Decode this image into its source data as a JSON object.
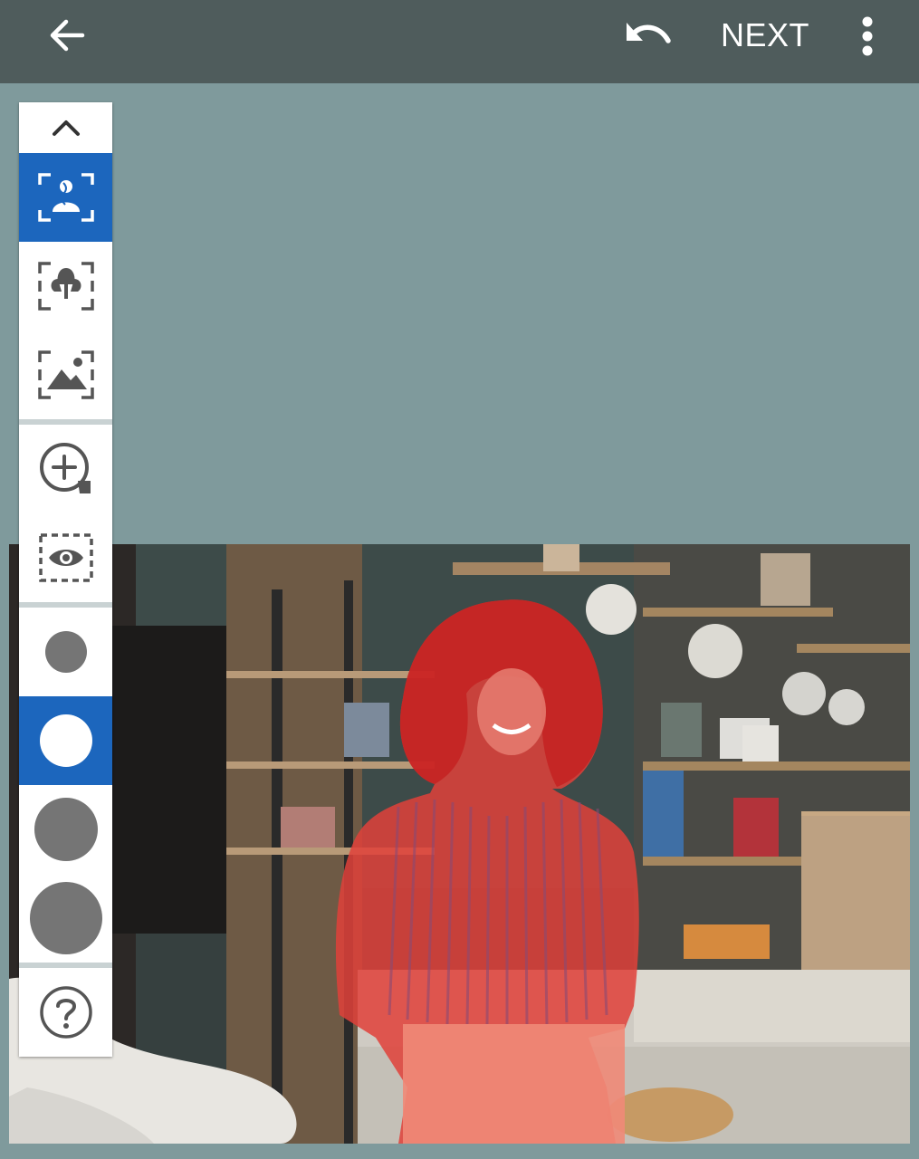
{
  "topbar": {
    "back_icon": "arrow-left-icon",
    "undo_icon": "undo-icon",
    "next_label": "NEXT",
    "more_icon": "more-vertical-icon"
  },
  "toolbar": {
    "tools": [
      {
        "name": "collapse",
        "icon": "chevron-up-icon",
        "selected": false
      },
      {
        "name": "person-select",
        "icon": "person-focus-icon",
        "selected": true
      },
      {
        "name": "object-select",
        "icon": "object-focus-icon",
        "selected": false
      },
      {
        "name": "background-select",
        "icon": "landscape-focus-icon",
        "selected": false
      },
      {
        "name": "add-area",
        "icon": "add-circle-icon",
        "selected": false
      },
      {
        "name": "preview",
        "icon": "eye-icon",
        "selected": false
      },
      {
        "name": "brush-small",
        "icon": "brush-size-small-icon",
        "selected": false
      },
      {
        "name": "brush-medium",
        "icon": "brush-size-medium-icon",
        "selected": true
      },
      {
        "name": "brush-large",
        "icon": "brush-size-large-icon",
        "selected": false
      },
      {
        "name": "brush-xlarge",
        "icon": "brush-size-xlarge-icon",
        "selected": false
      },
      {
        "name": "help",
        "icon": "help-circle-icon",
        "selected": false
      }
    ]
  },
  "colors": {
    "topbar": "#4f5c5c",
    "canvas": "#7f9a9c",
    "selected_tool": "#1c66bd",
    "selection_overlay": "#e0413a"
  }
}
